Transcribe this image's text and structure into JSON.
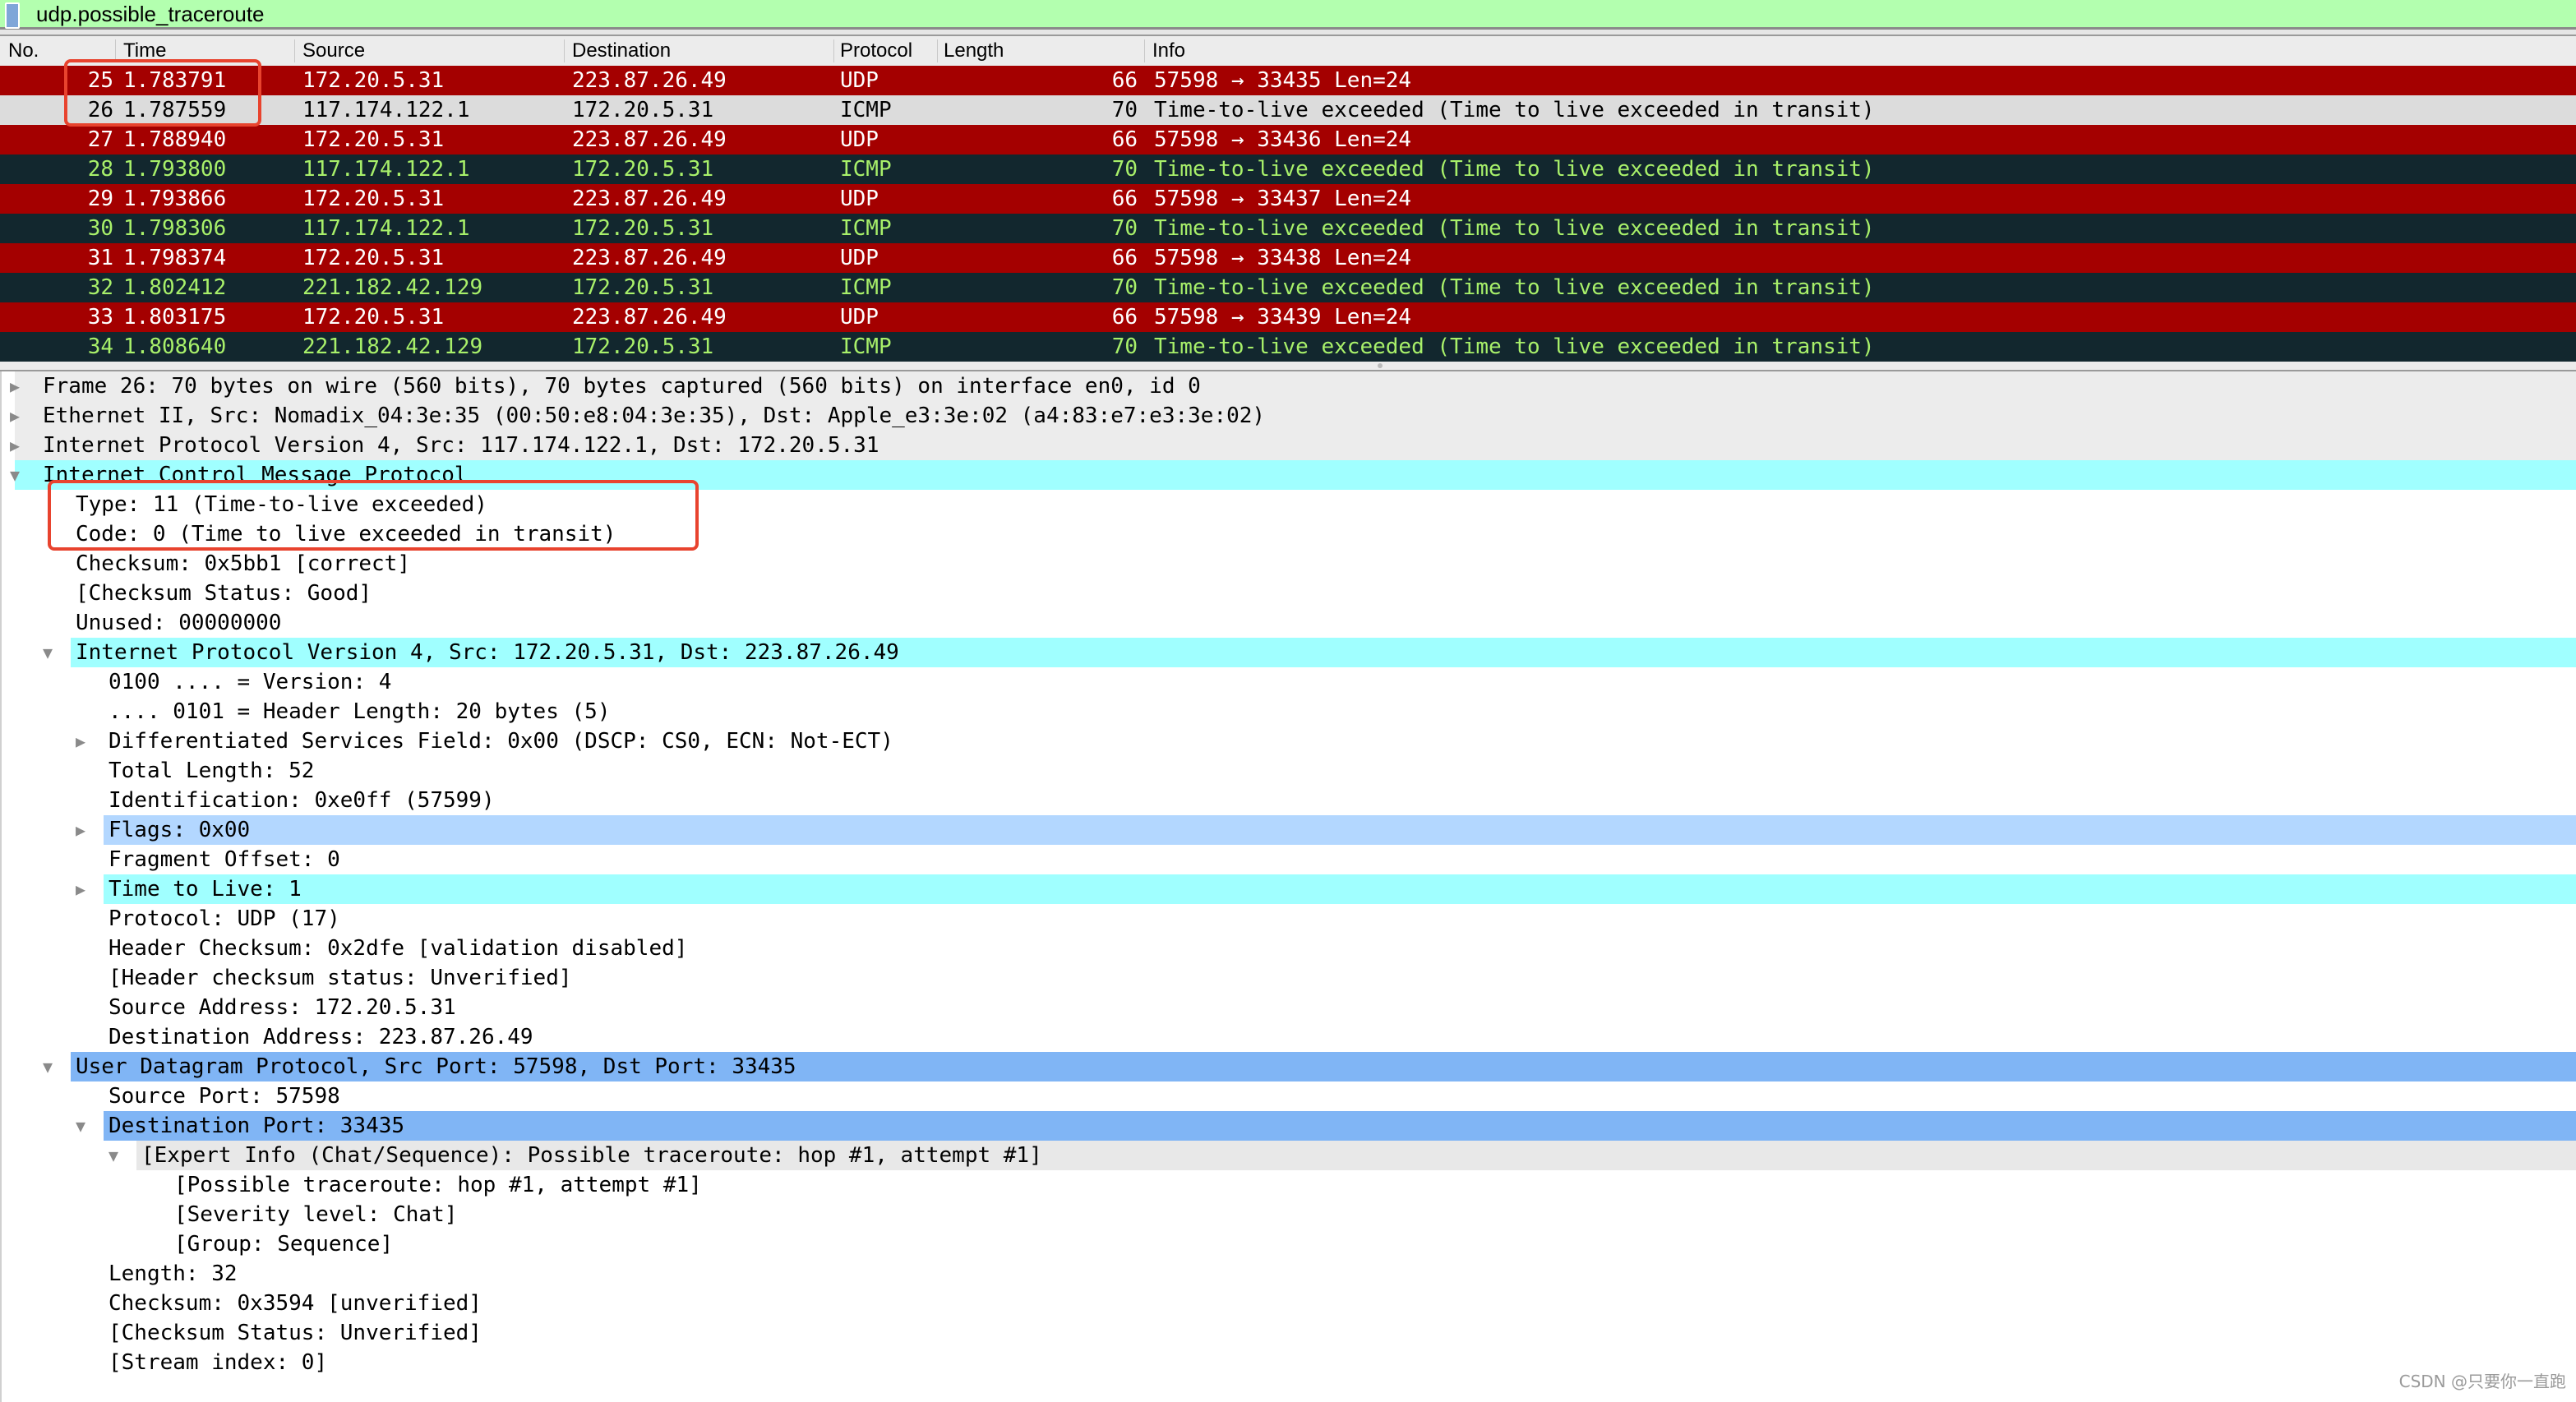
{
  "filter": {
    "value": "udp.possible_traceroute",
    "icon": "bookmark-icon",
    "bg_color": "#b3ffaf"
  },
  "columns": {
    "no": "No.",
    "time": "Time",
    "source": "Source",
    "destination": "Destination",
    "protocol": "Protocol",
    "length": "Length",
    "info": "Info"
  },
  "colors": {
    "udp_bg": "#a40000",
    "udp_fg": "#ffffff",
    "icmp_bg": "#12272e",
    "icmp_fg": "#a8f06a",
    "selected_bg": "#dcdcdc",
    "highlight_box": "#e8432e"
  },
  "packets": [
    {
      "no": "25",
      "time": "1.783791",
      "source": "172.20.5.31",
      "destination": "223.87.26.49",
      "protocol": "UDP",
      "length": "66",
      "info": "57598 → 33435 Len=24"
    },
    {
      "no": "26",
      "time": "1.787559",
      "source": "117.174.122.1",
      "destination": "172.20.5.31",
      "protocol": "ICMP",
      "length": "70",
      "info": "Time-to-live exceeded (Time to live exceeded in transit)",
      "selected": true
    },
    {
      "no": "27",
      "time": "1.788940",
      "source": "172.20.5.31",
      "destination": "223.87.26.49",
      "protocol": "UDP",
      "length": "66",
      "info": "57598 → 33436 Len=24"
    },
    {
      "no": "28",
      "time": "1.793800",
      "source": "117.174.122.1",
      "destination": "172.20.5.31",
      "protocol": "ICMP",
      "length": "70",
      "info": "Time-to-live exceeded (Time to live exceeded in transit)"
    },
    {
      "no": "29",
      "time": "1.793866",
      "source": "172.20.5.31",
      "destination": "223.87.26.49",
      "protocol": "UDP",
      "length": "66",
      "info": "57598 → 33437 Len=24"
    },
    {
      "no": "30",
      "time": "1.798306",
      "source": "117.174.122.1",
      "destination": "172.20.5.31",
      "protocol": "ICMP",
      "length": "70",
      "info": "Time-to-live exceeded (Time to live exceeded in transit)"
    },
    {
      "no": "31",
      "time": "1.798374",
      "source": "172.20.5.31",
      "destination": "223.87.26.49",
      "protocol": "UDP",
      "length": "66",
      "info": "57598 → 33438 Len=24"
    },
    {
      "no": "32",
      "time": "1.802412",
      "source": "221.182.42.129",
      "destination": "172.20.5.31",
      "protocol": "ICMP",
      "length": "70",
      "info": "Time-to-live exceeded (Time to live exceeded in transit)"
    },
    {
      "no": "33",
      "time": "1.803175",
      "source": "172.20.5.31",
      "destination": "223.87.26.49",
      "protocol": "UDP",
      "length": "66",
      "info": "57598 → 33439 Len=24"
    },
    {
      "no": "34",
      "time": "1.808640",
      "source": "221.182.42.129",
      "destination": "172.20.5.31",
      "protocol": "ICMP",
      "length": "70",
      "info": "Time-to-live exceeded (Time to live exceeded in transit)"
    }
  ],
  "details": [
    {
      "level": 0,
      "state": "collapsed",
      "bg": "#ececec",
      "text": "Frame 26: 70 bytes on wire (560 bits), 70 bytes captured (560 bits) on interface en0, id 0"
    },
    {
      "level": 0,
      "state": "collapsed",
      "bg": "#ececec",
      "text": "Ethernet II, Src: Nomadix_04:3e:35 (00:50:e8:04:3e:35), Dst: Apple_e3:3e:02 (a4:83:e7:e3:3e:02)"
    },
    {
      "level": 0,
      "state": "collapsed",
      "bg": "#ececec",
      "text": "Internet Protocol Version 4, Src: 117.174.122.1, Dst: 172.20.5.31"
    },
    {
      "level": 0,
      "state": "expanded",
      "bg": "#a0ffff",
      "text": "Internet Control Message Protocol"
    },
    {
      "level": 1,
      "text": "Type: 11 (Time-to-live exceeded)"
    },
    {
      "level": 1,
      "text": "Code: 0 (Time to live exceeded in transit)"
    },
    {
      "level": 1,
      "text": "Checksum: 0x5bb1 [correct]"
    },
    {
      "level": 1,
      "text": "[Checksum Status: Good]"
    },
    {
      "level": 1,
      "text": "Unused: 00000000"
    },
    {
      "level": 1,
      "state": "expanded",
      "bg": "#a0ffff",
      "text": "Internet Protocol Version 4, Src: 172.20.5.31, Dst: 223.87.26.49"
    },
    {
      "level": 2,
      "text": "0100 .... = Version: 4"
    },
    {
      "level": 2,
      "text": ".... 0101 = Header Length: 20 bytes (5)"
    },
    {
      "level": 2,
      "state": "collapsed",
      "text": "Differentiated Services Field: 0x00 (DSCP: CS0, ECN: Not-ECT)"
    },
    {
      "level": 2,
      "text": "Total Length: 52"
    },
    {
      "level": 2,
      "text": "Identification: 0xe0ff (57599)"
    },
    {
      "level": 2,
      "state": "collapsed",
      "bg": "#b3d7ff",
      "text": "Flags: 0x00"
    },
    {
      "level": 2,
      "text": "Fragment Offset: 0"
    },
    {
      "level": 2,
      "state": "collapsed",
      "bg": "#a0ffff",
      "text": "Time to Live: 1"
    },
    {
      "level": 2,
      "text": "Protocol: UDP (17)"
    },
    {
      "level": 2,
      "text": "Header Checksum: 0x2dfe [validation disabled]"
    },
    {
      "level": 2,
      "text": "[Header checksum status: Unverified]"
    },
    {
      "level": 2,
      "text": "Source Address: 172.20.5.31"
    },
    {
      "level": 2,
      "text": "Destination Address: 223.87.26.49"
    },
    {
      "level": 1,
      "state": "expanded",
      "bg": "#80b5f5",
      "text": "User Datagram Protocol, Src Port: 57598, Dst Port: 33435"
    },
    {
      "level": 2,
      "text": "Source Port: 57598"
    },
    {
      "level": 2,
      "state": "expanded",
      "bg": "#80b5f5",
      "text": "Destination Port: 33435"
    },
    {
      "level": 3,
      "state": "expanded",
      "bg": "#e8e8e8",
      "text": "[Expert Info (Chat/Sequence): Possible traceroute: hop #1, attempt #1]"
    },
    {
      "level": 4,
      "text": "[Possible traceroute: hop #1, attempt #1]"
    },
    {
      "level": 4,
      "text": "[Severity level: Chat]"
    },
    {
      "level": 4,
      "text": "[Group: Sequence]"
    },
    {
      "level": 2,
      "text": "Length: 32"
    },
    {
      "level": 2,
      "text": "Checksum: 0x3594 [unverified]"
    },
    {
      "level": 2,
      "text": "[Checksum Status: Unverified]"
    },
    {
      "level": 2,
      "text": "[Stream index: 0]"
    }
  ],
  "watermark": "CSDN @只要你一直跑"
}
